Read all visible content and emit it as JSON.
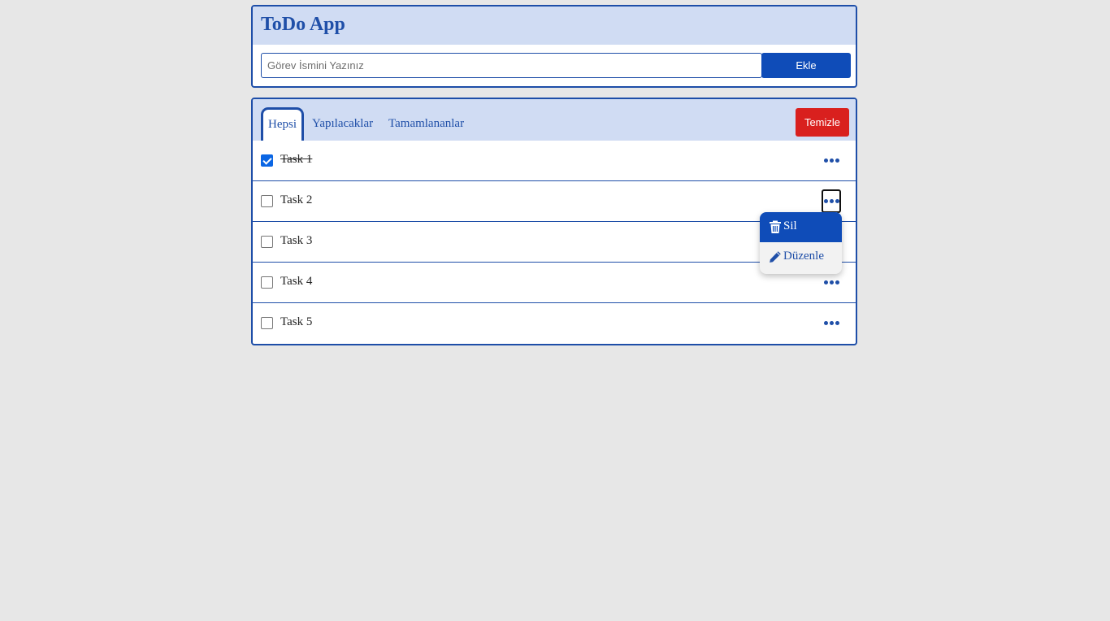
{
  "app": {
    "title": "ToDo App"
  },
  "add_form": {
    "placeholder": "Görev İsmini Yazınız",
    "value": "",
    "add_label": "Ekle"
  },
  "filters": {
    "tabs": [
      {
        "label": "Hepsi",
        "active": true
      },
      {
        "label": "Yapılacaklar",
        "active": false
      },
      {
        "label": "Tamamlananlar",
        "active": false
      }
    ],
    "clear_label": "Temizle"
  },
  "tasks": [
    {
      "label": "Task 1",
      "completed": true
    },
    {
      "label": "Task 2",
      "completed": false
    },
    {
      "label": "Task 3",
      "completed": false
    },
    {
      "label": "Task 4",
      "completed": false
    },
    {
      "label": "Task 5",
      "completed": false
    }
  ],
  "context_menu": {
    "open_for_task": "Task 2",
    "items": [
      {
        "label": "Sil",
        "icon": "trash-icon",
        "highlighted": true
      },
      {
        "label": "Düzenle",
        "icon": "pencil-icon",
        "highlighted": false
      }
    ]
  },
  "colors": {
    "primary": "#0f4cb8",
    "header_bg": "#d0dcf3",
    "danger": "#d9201e",
    "page_bg": "#e7e7e7",
    "checkbox_checked": "#0b66e4"
  }
}
